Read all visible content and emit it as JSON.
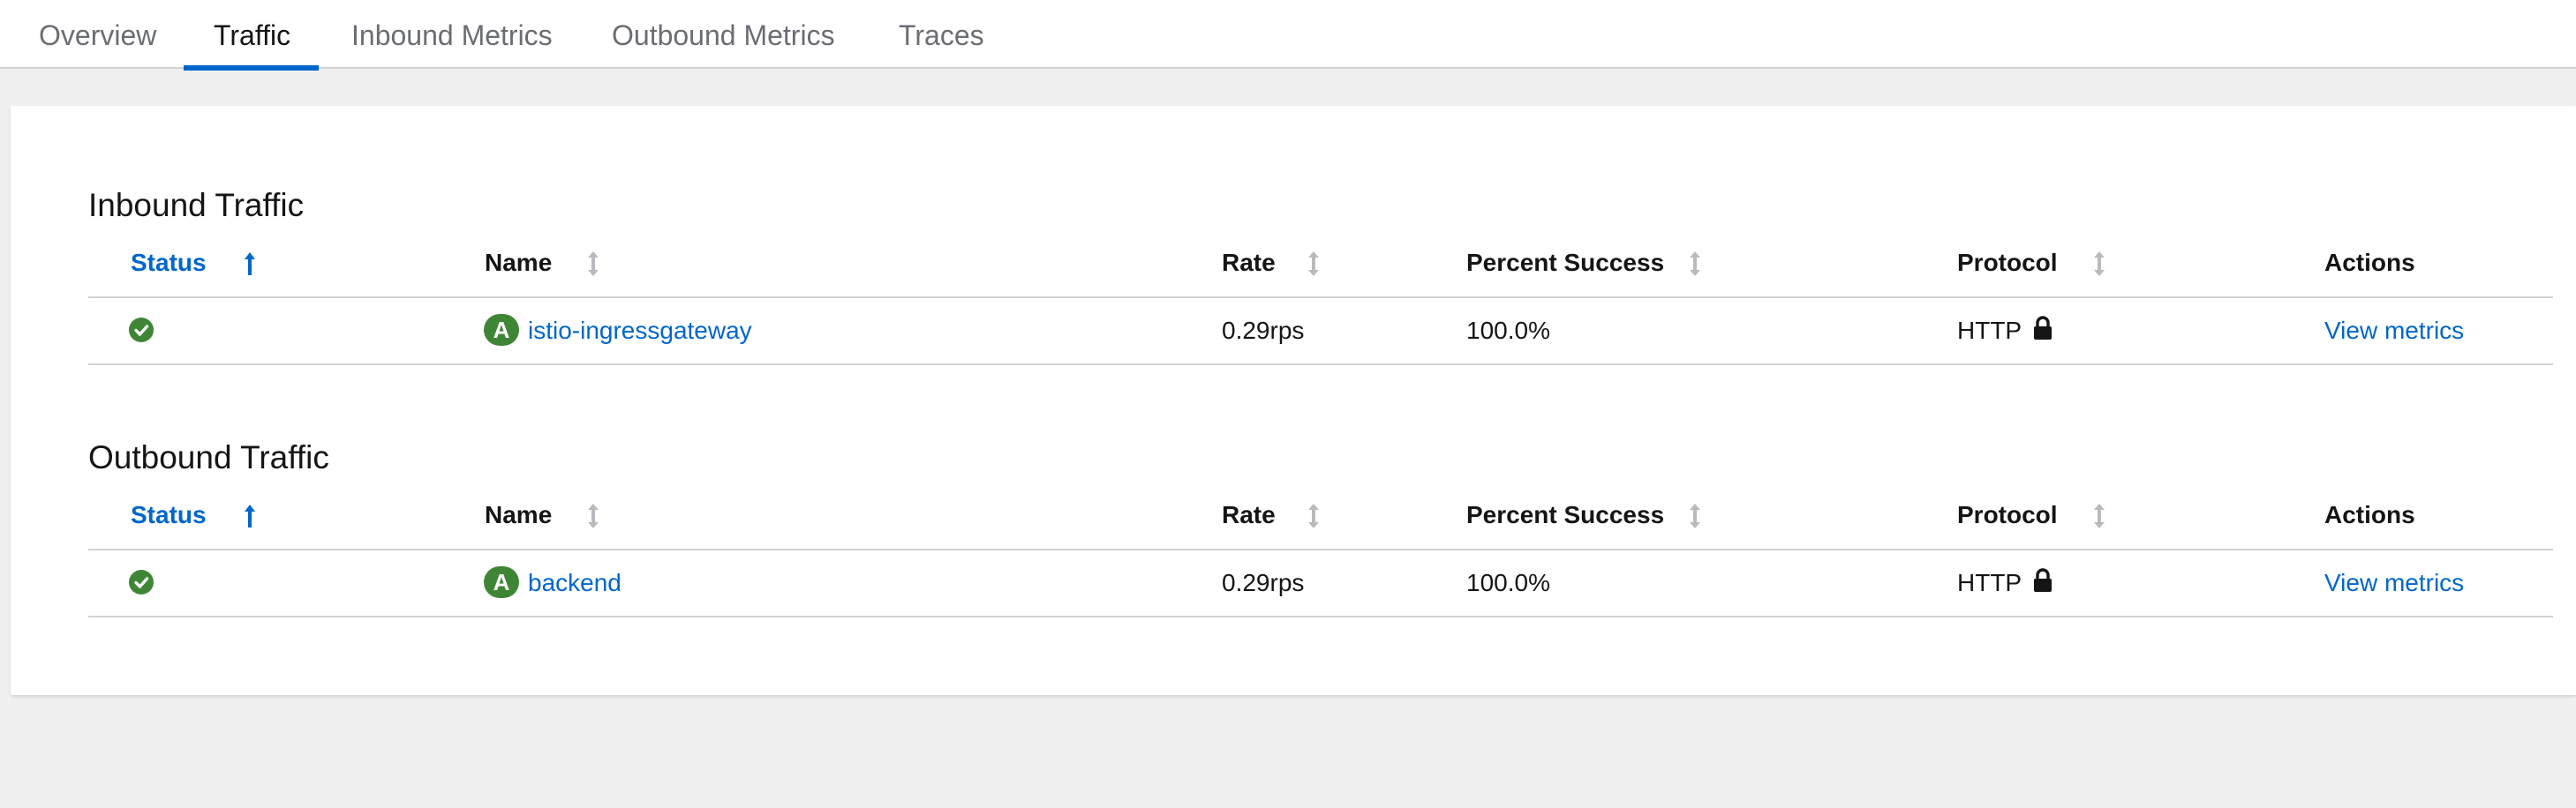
{
  "tabs": [
    {
      "label": "Overview",
      "active": false
    },
    {
      "label": "Traffic",
      "active": true
    },
    {
      "label": "Inbound Metrics",
      "active": false
    },
    {
      "label": "Outbound Metrics",
      "active": false
    },
    {
      "label": "Traces",
      "active": false
    }
  ],
  "columns": {
    "status": "Status",
    "name": "Name",
    "rate": "Rate",
    "percent_success": "Percent Success",
    "protocol": "Protocol",
    "actions": "Actions"
  },
  "sections": [
    {
      "title": "Inbound Traffic",
      "rows": [
        {
          "status": "healthy",
          "badge": "A",
          "name": "istio-ingressgateway",
          "rate": "0.29rps",
          "percent_success": "100.0%",
          "protocol": "HTTP",
          "secure": true,
          "action": "View metrics"
        }
      ]
    },
    {
      "title": "Outbound Traffic",
      "rows": [
        {
          "status": "healthy",
          "badge": "A",
          "name": "backend",
          "rate": "0.29rps",
          "percent_success": "100.0%",
          "protocol": "HTTP",
          "secure": true,
          "action": "View metrics"
        }
      ]
    }
  ],
  "icons": {
    "status_ok": "check-circle-icon",
    "sort_active": "arrow-up-icon",
    "sort_inactive": "sort-icon",
    "protocol_secure": "lock-icon",
    "app_badge": "app-badge"
  },
  "colors": {
    "accent": "#0066cc",
    "success": "#3e8635",
    "tab_inactive": "#6a6e73",
    "sort_inactive": "#b8bbbe"
  }
}
